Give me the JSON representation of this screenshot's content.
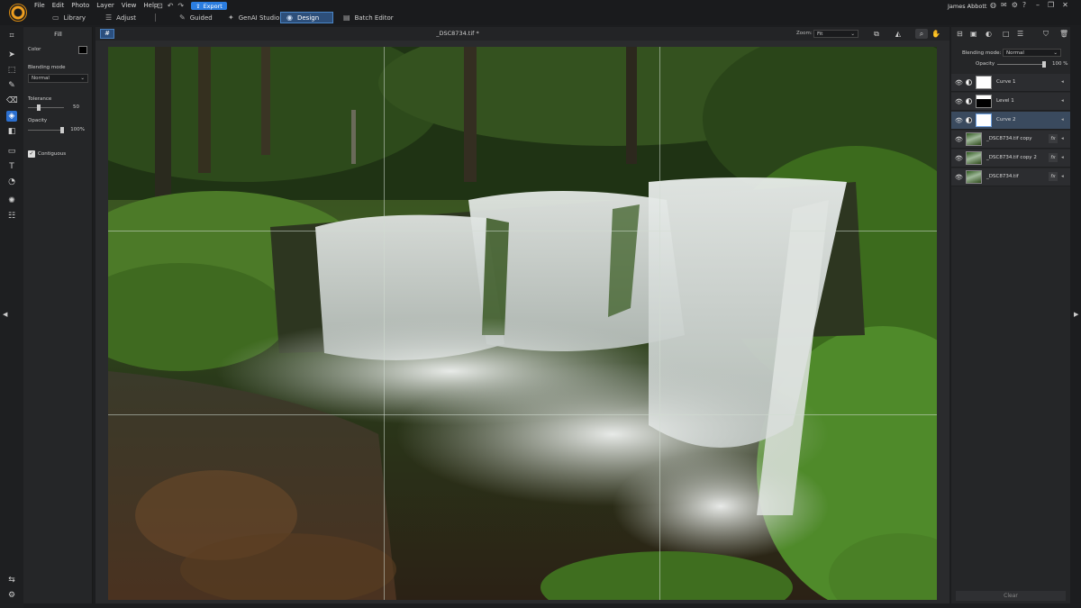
{
  "menu": [
    "File",
    "Edit",
    "Photo",
    "Layer",
    "View",
    "Help"
  ],
  "quick_actions": {
    "save_icon": "save-icon",
    "undo_icon": "undo-icon",
    "redo_icon": "redo-icon"
  },
  "export_label": "Export",
  "modes": [
    {
      "label": "Library",
      "icon": "library-icon"
    },
    {
      "label": "Adjust",
      "icon": "sliders-icon"
    },
    {
      "label": "Guided",
      "icon": "wand-icon"
    },
    {
      "label": "GenAI Studio",
      "icon": "genai-icon"
    },
    {
      "label": "Design",
      "icon": "design-icon",
      "active": true
    },
    {
      "label": "Batch Editor",
      "icon": "batch-icon"
    }
  ],
  "user_name": "James Abbott",
  "options_panel": {
    "title": "Fill",
    "color_label": "Color",
    "color_value": "#000000",
    "blending_label": "Blending mode",
    "blending_value": "Normal",
    "tolerance_label": "Tolerance",
    "tolerance_value": "50",
    "opacity_label": "Opacity",
    "opacity_value": "100%",
    "contiguous_label": "Contiguous",
    "contiguous_checked": true
  },
  "canvas": {
    "doc_title": "_DSC8734.tif *",
    "zoom_label": "Zoom:",
    "zoom_value": "Fit"
  },
  "layers_panel": {
    "blending_label": "Blending mode:",
    "blending_value": "Normal",
    "opacity_label": "Opacity",
    "opacity_value": "100 %",
    "layers": [
      {
        "name": "Curve 1",
        "kind": "adjustment",
        "thumb": "white",
        "selected": false
      },
      {
        "name": "Level 1",
        "kind": "adjustment",
        "thumb": "black",
        "selected": false
      },
      {
        "name": "Curve 2",
        "kind": "adjustment",
        "thumb": "white",
        "selected": true
      },
      {
        "name": "_DSC8734.tif copy",
        "kind": "image",
        "selected": false
      },
      {
        "name": "_DSC8734.tif copy 2",
        "kind": "image",
        "selected": false
      },
      {
        "name": "_DSC8734.tif",
        "kind": "image",
        "selected": false
      }
    ],
    "clear_label": "Clear"
  },
  "colors": {
    "accent": "#2b7de0",
    "selected_layer": "#3a4a5e",
    "active_tool": "#2b6fcf"
  }
}
